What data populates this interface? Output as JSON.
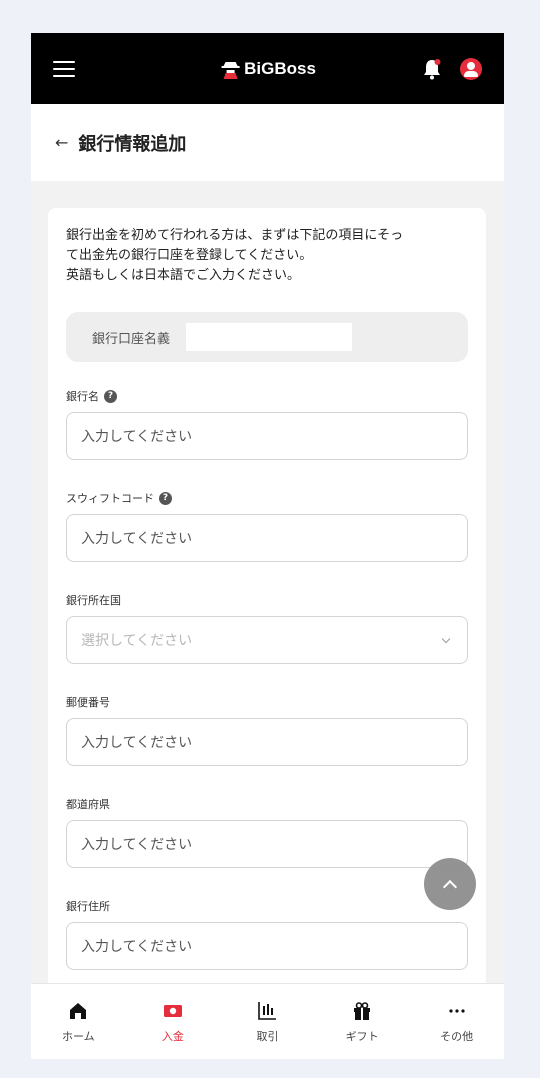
{
  "header": {
    "brand": "BiGBoss",
    "menu_icon": "hamburger-icon",
    "bell_icon": "bell-icon",
    "avatar_icon": "user-avatar-icon",
    "accent_color": "#e52d3b"
  },
  "page": {
    "back": "←",
    "title": "銀行情報追加"
  },
  "intro": {
    "line1": "銀行出金を初めて行われる方は、まずは下記の項目にそっ",
    "line2": "て出金先の銀行口座を登録してください。",
    "line3": "英語もしくは日本語でご入力ください。"
  },
  "account_holder": {
    "label": "銀行口座名義",
    "value": ""
  },
  "fields": [
    {
      "label": "銀行名",
      "placeholder": "入力してください",
      "help": "?"
    },
    {
      "label": "スウィフトコード",
      "placeholder": "入力してください",
      "help": "?"
    },
    {
      "label": "銀行所在国",
      "placeholder": "選択してください"
    },
    {
      "label": "郵便番号",
      "placeholder": "入力してください"
    },
    {
      "label": "都道府県",
      "placeholder": "入力してください"
    },
    {
      "label": "銀行住所",
      "placeholder": "入力してください"
    }
  ],
  "bottom_nav": [
    {
      "label": "ホーム",
      "icon": "home-icon"
    },
    {
      "label": "入金",
      "icon": "deposit-icon"
    },
    {
      "label": "取引",
      "icon": "trade-icon"
    },
    {
      "label": "ギフト",
      "icon": "gift-icon"
    },
    {
      "label": "その他",
      "icon": "more-icon"
    }
  ]
}
